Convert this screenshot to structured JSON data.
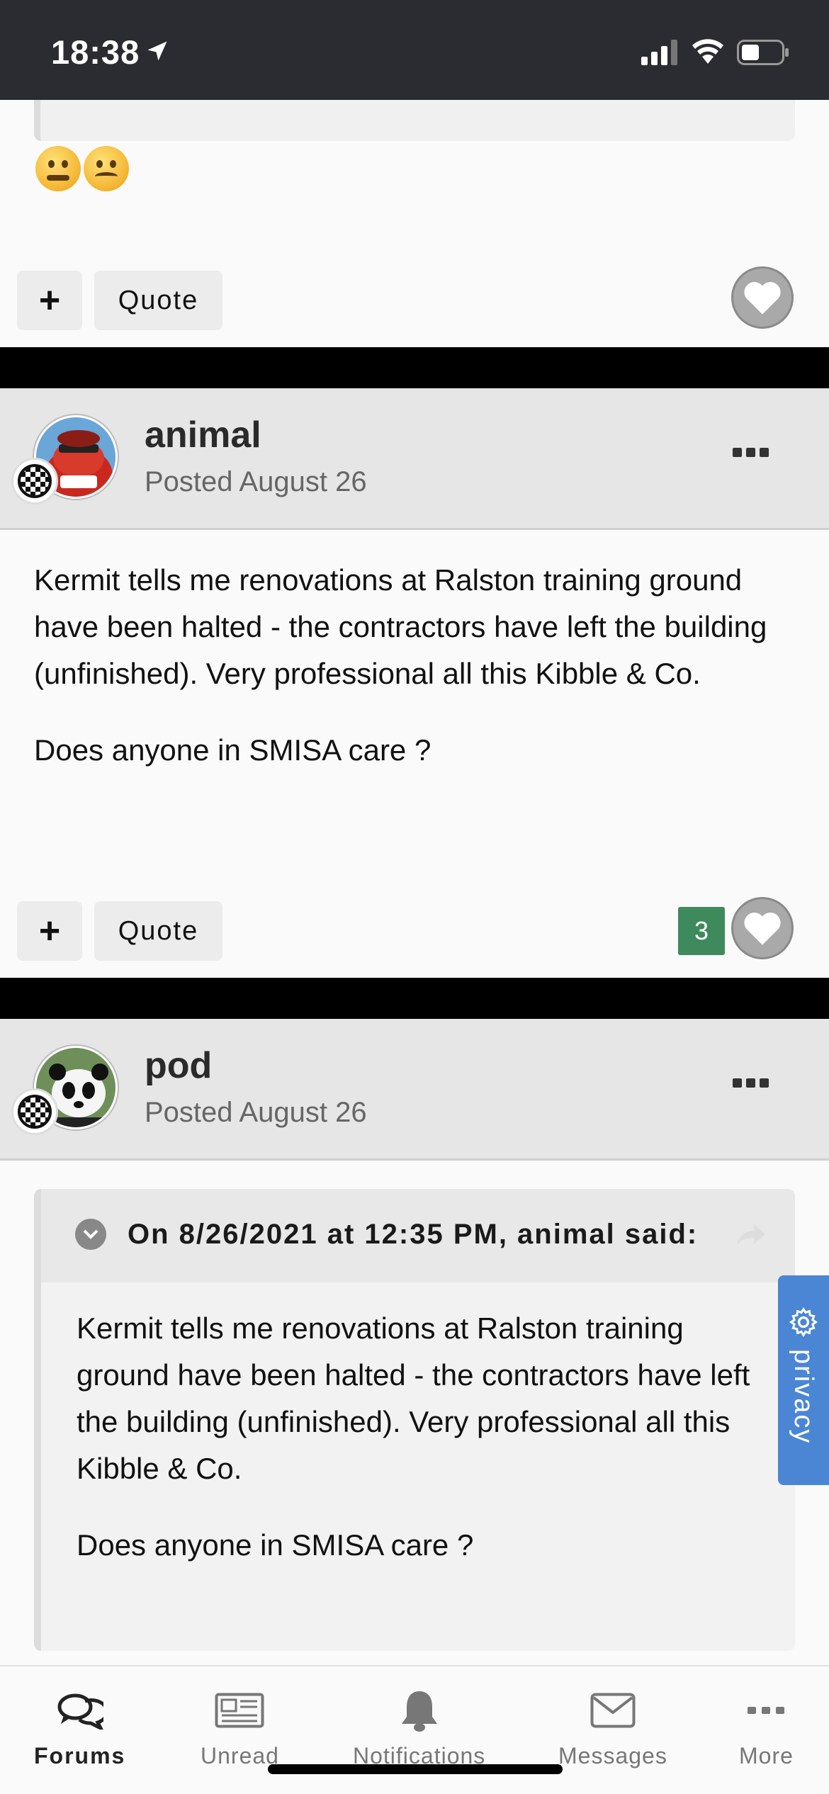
{
  "status_bar": {
    "time": "18:38"
  },
  "post1_actions": {
    "plus_label": "+",
    "quote_label": "Quote"
  },
  "post2": {
    "author": "animal",
    "posted": "Posted August 26",
    "paragraphs": [
      "Kermit tells me renovations at Ralston training ground have been halted - the contractors have left the building (unfinished).  Very professional all this Kibble & Co.",
      "Does anyone in SMISA care ?"
    ],
    "plus_label": "+",
    "quote_label": "Quote",
    "like_count": "3"
  },
  "post3": {
    "author": "pod",
    "posted": "Posted August 26",
    "quote_attribution": "On 8/26/2021 at 12:35 PM, animal said:",
    "quote_paragraphs": [
      "Kermit tells me renovations at Ralston training ground have been halted - the contractors have left the building (unfinished).  Very professional all this Kibble & Co.",
      "Does anyone in SMISA care ?"
    ]
  },
  "privacy_tab": {
    "label": "privacy"
  },
  "tabbar": {
    "items": [
      {
        "label": "Forums",
        "icon": "chat-bubbles-icon"
      },
      {
        "label": "Unread",
        "icon": "newspaper-icon"
      },
      {
        "label": "Notifications",
        "icon": "bell-icon"
      },
      {
        "label": "Messages",
        "icon": "envelope-icon"
      },
      {
        "label": "More",
        "icon": "more-dots-icon"
      }
    ],
    "active": "Forums"
  },
  "colors": {
    "reaction_green": "#3f8a5d",
    "privacy_blue": "#4a86d4",
    "status_bar": "#2b2c31"
  }
}
